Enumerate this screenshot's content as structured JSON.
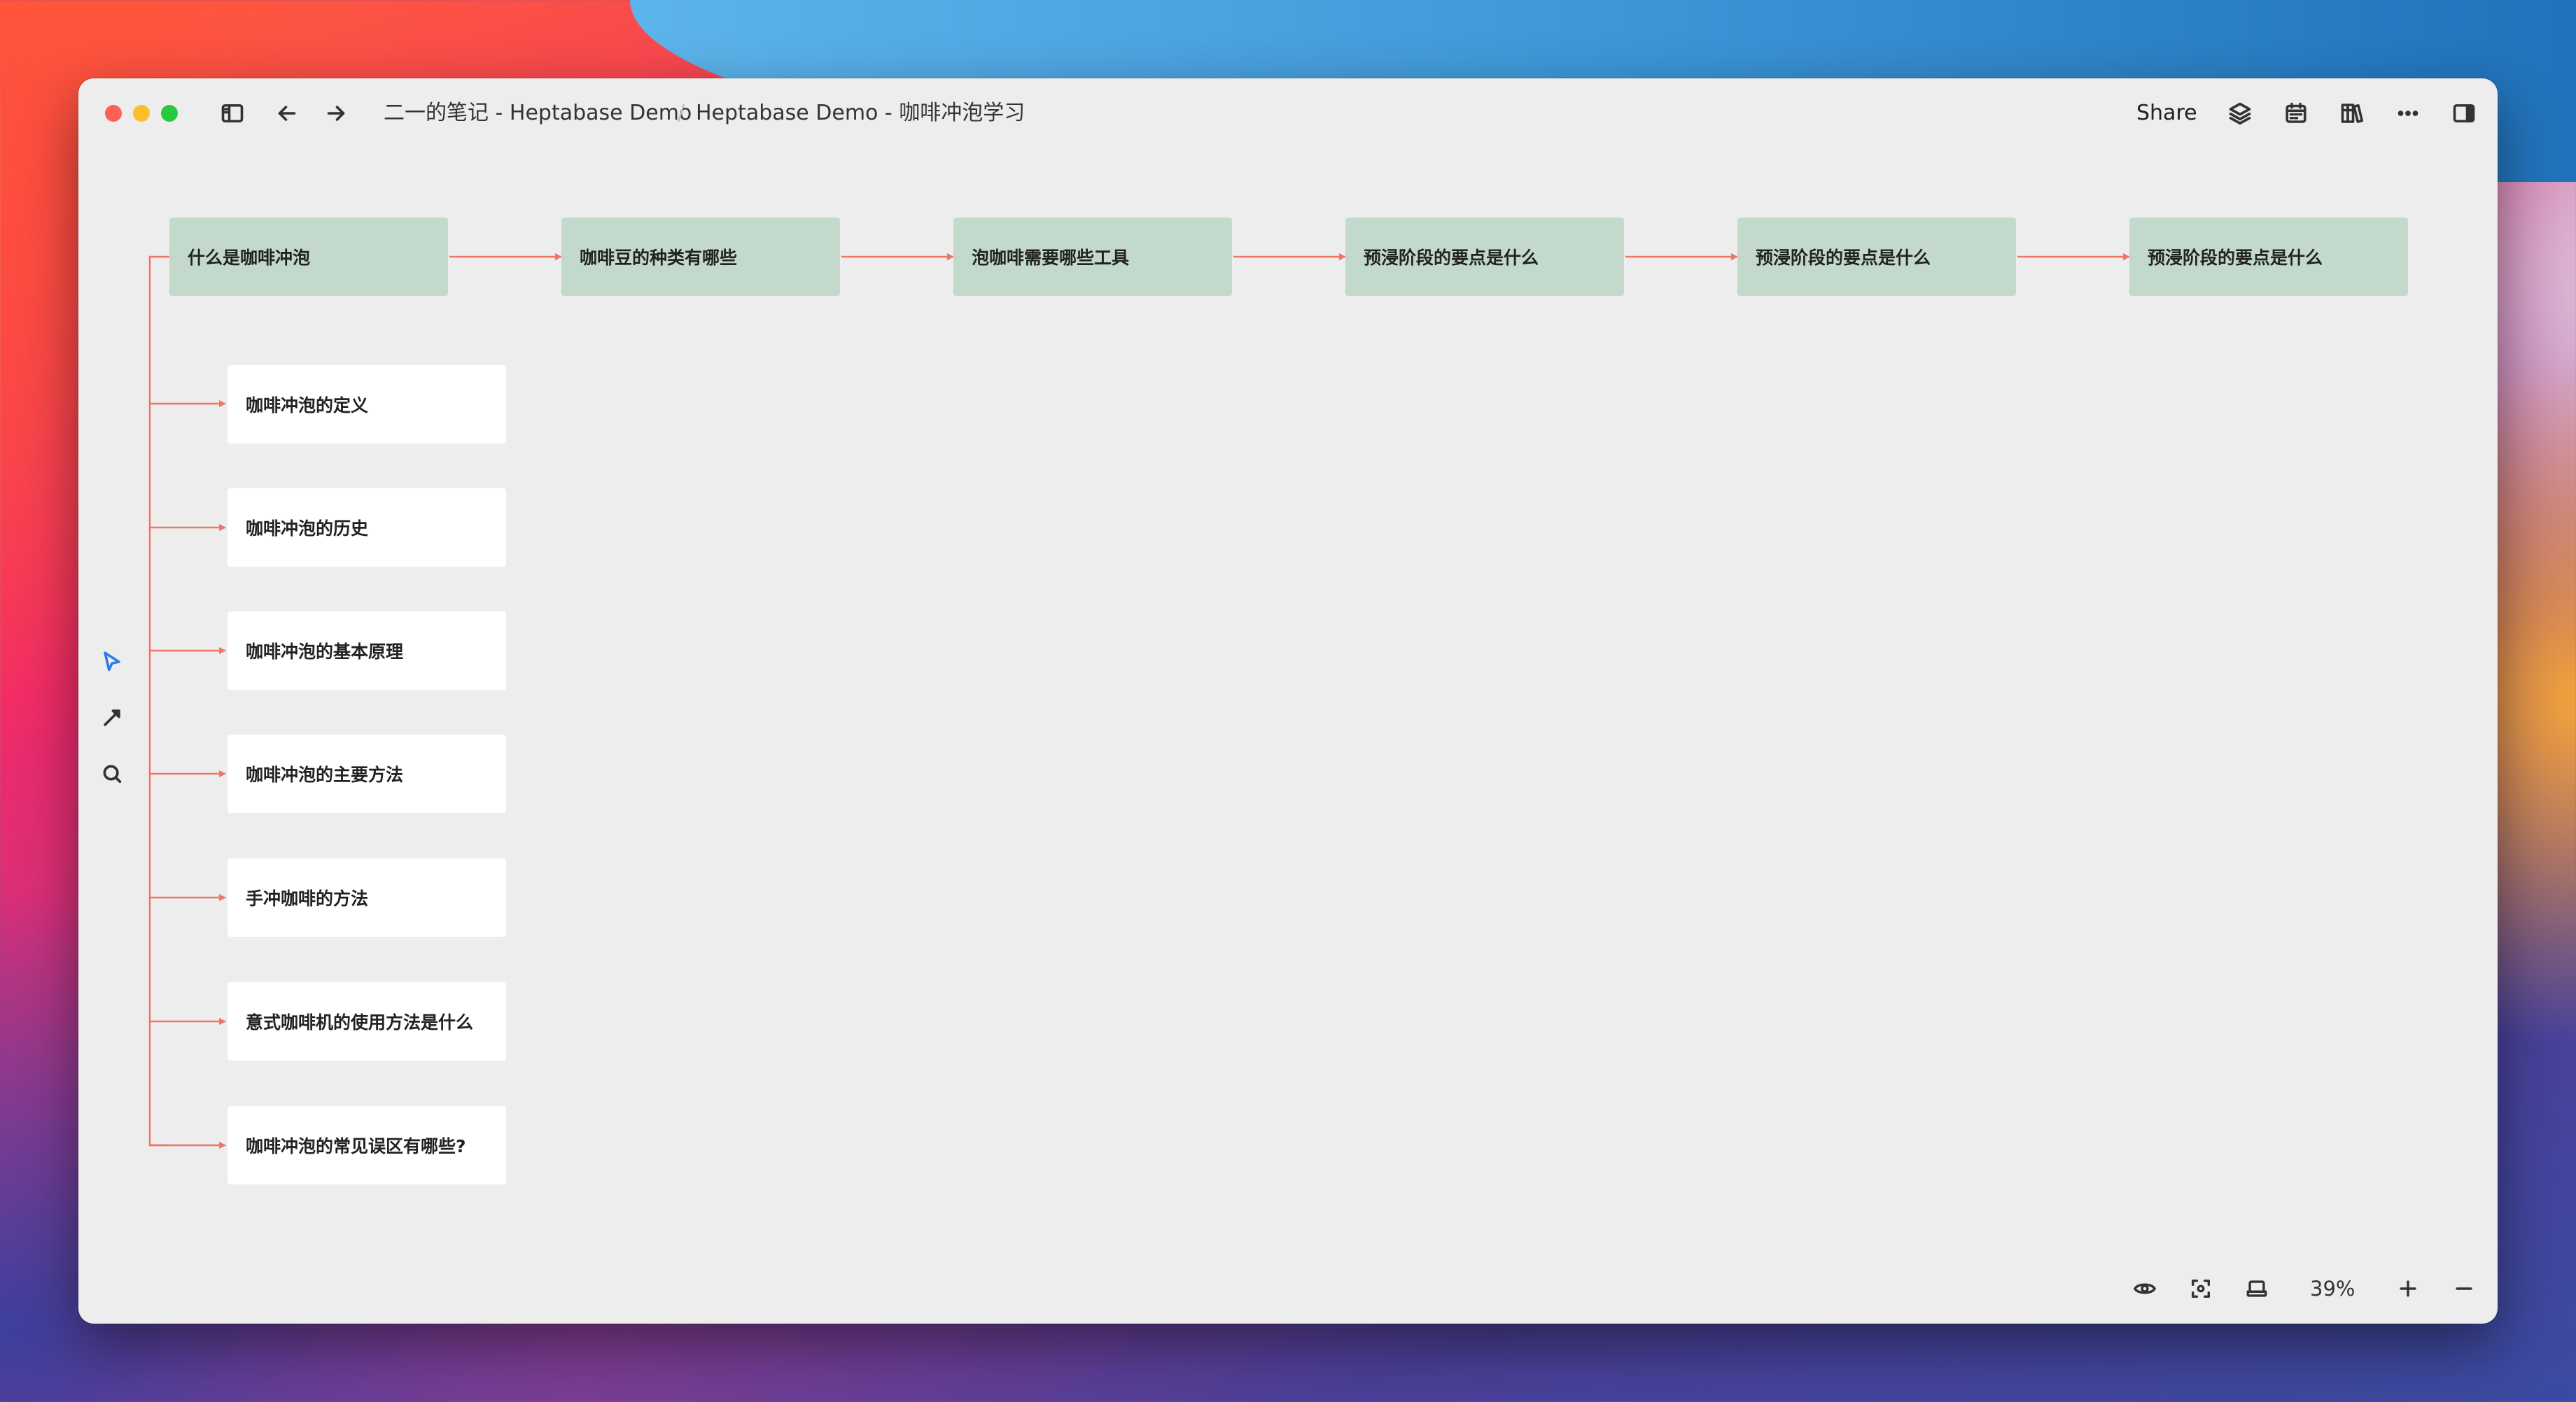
{
  "titlebar": {
    "breadcrumb_parent": "二一的笔记 - Heptabase Demo",
    "breadcrumb_separator": "/",
    "breadcrumb_current": "Heptabase Demo - 咖啡冲泡学习",
    "share_label": "Share"
  },
  "toolbar_icons": [
    "sidebar-toggle-icon",
    "back-arrow-icon",
    "forward-arrow-icon",
    "layers-icon",
    "calendar-icon",
    "library-icon",
    "more-icon",
    "right-panel-icon"
  ],
  "left_tools": [
    "select-cursor-icon",
    "arrow-tool-icon",
    "search-icon"
  ],
  "top_cards": [
    "什么是咖啡冲泡",
    "咖啡豆的种类有哪些",
    "泡咖啡需要哪些工具",
    "预浸阶段的要点是什么",
    "预浸阶段的要点是什么",
    "预浸阶段的要点是什么"
  ],
  "sub_cards": [
    "咖啡冲泡的定义",
    "咖啡冲泡的历史",
    "咖啡冲泡的基本原理",
    "咖啡冲泡的主要方法",
    "手冲咖啡的方法",
    "意式咖啡机的使用方法是什么",
    "咖啡冲泡的常见误区有哪些?"
  ],
  "colors": {
    "top_card_bg": "#c3d9cc",
    "sub_card_bg": "#ffffff",
    "connector": "#f07565",
    "active_tool": "#2f7de1"
  },
  "bottom_bar": {
    "zoom_label": "39%",
    "icons": [
      "eye-icon",
      "focus-icon",
      "laptop-icon",
      "zoom-in-icon",
      "zoom-out-icon"
    ]
  }
}
